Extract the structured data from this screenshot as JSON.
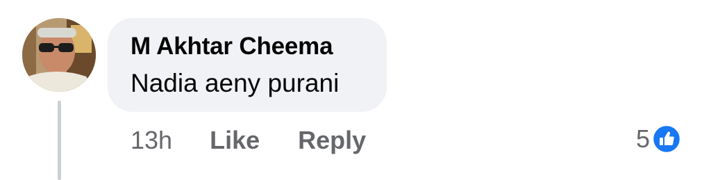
{
  "comment": {
    "author": "M Akhtar Cheema",
    "text": "Nadia aeny purani",
    "timestamp": "13h",
    "like_label": "Like",
    "reply_label": "Reply",
    "reaction_count": "5",
    "reaction_icon": "thumbs-up-icon",
    "reaction_color": "#1877f2",
    "bubble_color": "#f0f2f5"
  }
}
